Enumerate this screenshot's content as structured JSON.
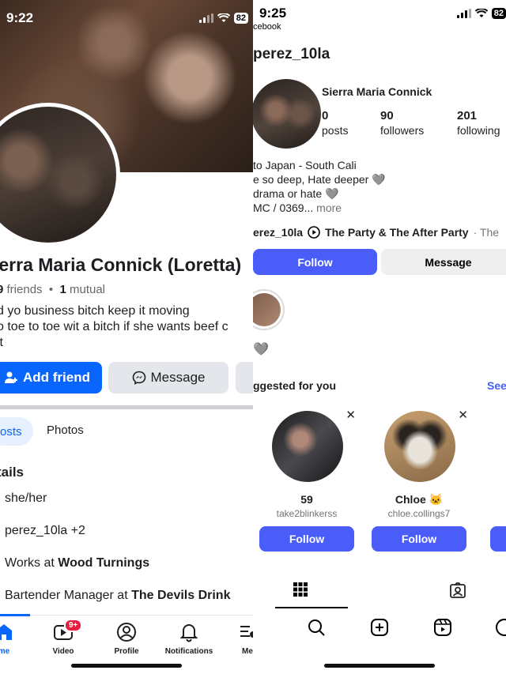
{
  "left": {
    "status": {
      "time": "9:22",
      "battery": "82"
    },
    "name": "ierra Maria Connick (Loretta)",
    "friends_count": "9",
    "friends_word": "friends",
    "mutual_count": "1",
    "mutual_word": "mutual",
    "bio": [
      "d yo business bitch keep it moving",
      "o toe to toe wit a bitch if she wants beef c",
      " it"
    ],
    "add_friend_label": "Add friend",
    "message_label": "Message",
    "tabs": {
      "posts": "osts",
      "photos": "Photos"
    },
    "details_heading": "tails",
    "details": [
      {
        "text": "she/her"
      },
      {
        "text": "perez_10la +2"
      },
      {
        "prefix": "Works at ",
        "bold": "Wood Turnings"
      },
      {
        "prefix": "Bartender Manager at ",
        "bold": "The Devils Drink"
      }
    ],
    "nav": [
      {
        "label": "me",
        "icon": "home-icon"
      },
      {
        "label": "Video",
        "icon": "video-icon",
        "badge": "9+"
      },
      {
        "label": "Profile",
        "icon": "profile-icon"
      },
      {
        "label": "Notifications",
        "icon": "bell-icon"
      },
      {
        "label": "Me",
        "icon": "menu-icon"
      }
    ],
    "accent": "#0866ff"
  },
  "right": {
    "status": {
      "time": "9:25",
      "battery": "82"
    },
    "back_label": "cebook",
    "username": "perez_10la",
    "full_name": "Sierra Maria Connick",
    "stats": [
      {
        "value": "0",
        "label": "posts"
      },
      {
        "value": "90",
        "label": "followers"
      },
      {
        "value": "201",
        "label": "following"
      }
    ],
    "bio": [
      "to Japan - South Cali",
      "e so deep, Hate deeper 🩶",
      "drama or hate 🩶",
      "MC / 0369..."
    ],
    "bio_more": "more",
    "link_handle": "erez_10la",
    "music_title": "The Party & The After Party",
    "music_suffix": "· The",
    "follow_label": "Follow",
    "message_label": "Message",
    "highlight_caption": "🩶",
    "suggested_heading": "ggested for you",
    "see_all": "See",
    "suggestions": [
      {
        "name": "59",
        "handle": "take2blinkerss",
        "button": "Follow"
      },
      {
        "name": "Chloe 🐱",
        "handle": "chloe.collings7",
        "button": "Follow"
      }
    ],
    "accent": "#4a5df9"
  }
}
